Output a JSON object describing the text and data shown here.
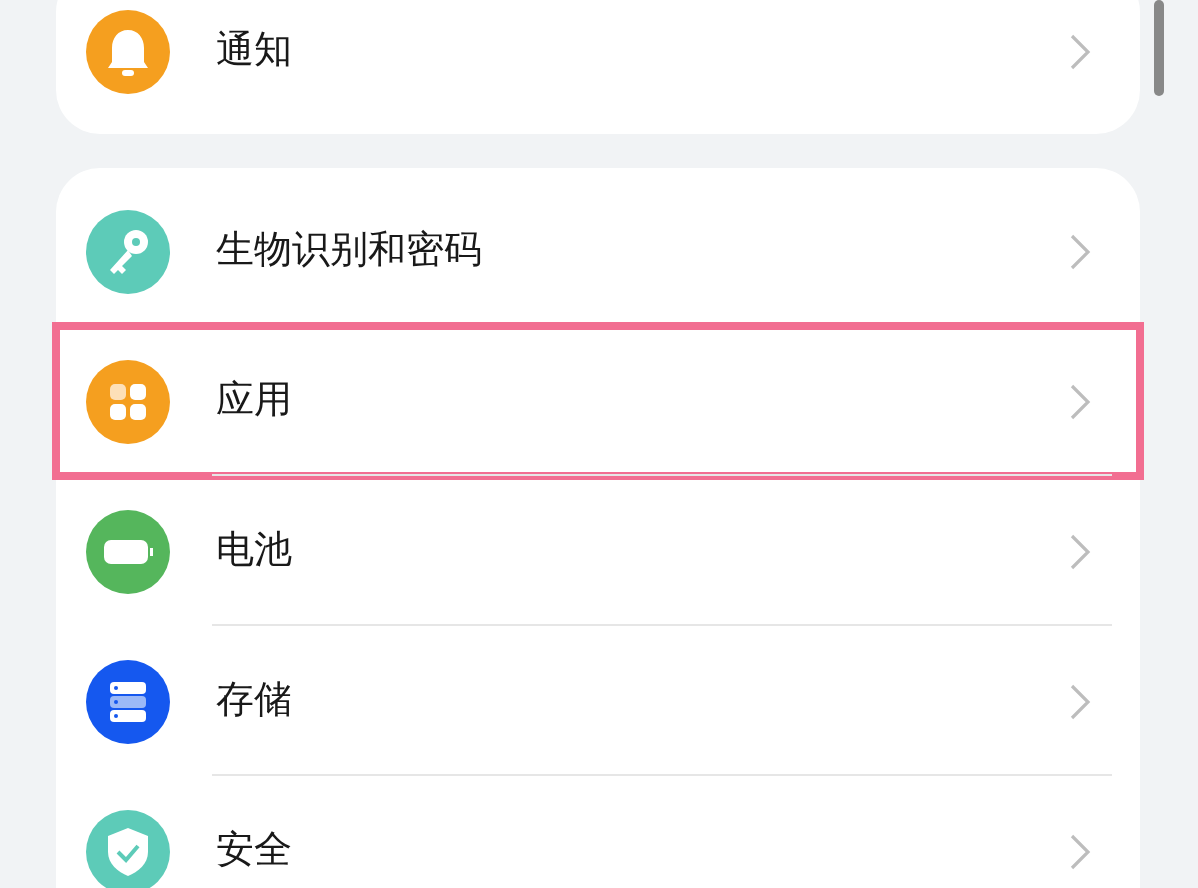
{
  "groups": [
    {
      "items": [
        {
          "label": "通知",
          "kind": "bell",
          "color": "#f59f1f",
          "highlighted": false
        }
      ]
    },
    {
      "items": [
        {
          "label": "生物识别和密码",
          "kind": "key",
          "color": "#5dcbb8",
          "highlighted": false
        },
        {
          "label": "应用",
          "kind": "apps",
          "color": "#f59f1f",
          "highlighted": true
        },
        {
          "label": "电池",
          "kind": "battery",
          "color": "#55b65c",
          "highlighted": false
        },
        {
          "label": "存储",
          "kind": "storage",
          "color": "#1558ef",
          "highlighted": false
        },
        {
          "label": "安全",
          "kind": "shield",
          "color": "#5dcbb8",
          "highlighted": false
        }
      ]
    }
  ]
}
